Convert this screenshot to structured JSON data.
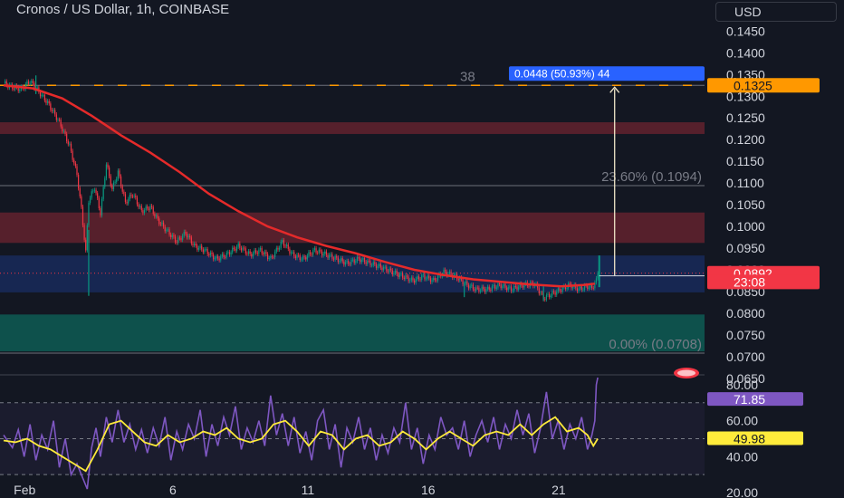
{
  "header": {
    "title": "Cronos / US Dollar, 1h, COINBASE",
    "currency_label": "USD"
  },
  "chart_data": [
    {
      "type": "candlestick",
      "title": "Cronos / US Dollar, 1h, COINBASE",
      "ylim": [
        0.066,
        0.148
      ],
      "y_ticks": [
        "0.1450",
        "0.1400",
        "0.1350",
        "0.1300",
        "0.1250",
        "0.1200",
        "0.1150",
        "0.1100",
        "0.1050",
        "0.1000",
        "0.0950",
        "0.0900",
        "0.0850",
        "0.0800",
        "0.0750",
        "0.0700",
        "0.0650"
      ],
      "x_ticks": [
        {
          "label": "Feb",
          "bar": 2
        },
        {
          "label": "6",
          "bar": 103
        },
        {
          "label": "11",
          "bar": 195
        },
        {
          "label": "16",
          "bar": 277
        },
        {
          "label": "21",
          "bar": 366
        }
      ],
      "price_series": {
        "name": "close",
        "points": [
          [
            0,
            0.133
          ],
          [
            5,
            0.1322
          ],
          [
            12,
            0.1316
          ],
          [
            18,
            0.1335
          ],
          [
            24,
            0.131
          ],
          [
            30,
            0.1285
          ],
          [
            38,
            0.124
          ],
          [
            45,
            0.1185
          ],
          [
            50,
            0.112
          ],
          [
            53,
            0.104
          ],
          [
            56,
            0.094
          ],
          [
            58,
            0.106
          ],
          [
            62,
            0.109
          ],
          [
            66,
            0.103
          ],
          [
            70,
            0.1145
          ],
          [
            74,
            0.1085
          ],
          [
            78,
            0.1125
          ],
          [
            83,
            0.1055
          ],
          [
            88,
            0.1075
          ],
          [
            94,
            0.1035
          ],
          [
            100,
            0.1045
          ],
          [
            105,
            0.1015
          ],
          [
            110,
            0.0995
          ],
          [
            118,
            0.0965
          ],
          [
            124,
            0.0985
          ],
          [
            130,
            0.0955
          ],
          [
            137,
            0.0945
          ],
          [
            145,
            0.0925
          ],
          [
            152,
            0.0935
          ],
          [
            160,
            0.0955
          ],
          [
            168,
            0.0935
          ],
          [
            175,
            0.0945
          ],
          [
            182,
            0.0925
          ],
          [
            190,
            0.0965
          ],
          [
            197,
            0.0935
          ],
          [
            204,
            0.0925
          ],
          [
            212,
            0.0945
          ],
          [
            220,
            0.0935
          ],
          [
            227,
            0.0925
          ],
          [
            234,
            0.0915
          ],
          [
            242,
            0.0925
          ],
          [
            250,
            0.0915
          ],
          [
            258,
            0.0905
          ],
          [
            265,
            0.0895
          ],
          [
            272,
            0.0885
          ],
          [
            279,
            0.0875
          ],
          [
            286,
            0.0885
          ],
          [
            293,
            0.0875
          ],
          [
            300,
            0.0895
          ],
          [
            308,
            0.0885
          ],
          [
            316,
            0.0865
          ],
          [
            322,
            0.0855
          ],
          [
            330,
            0.0855
          ],
          [
            338,
            0.0865
          ],
          [
            346,
            0.0855
          ],
          [
            354,
            0.0865
          ],
          [
            362,
            0.0868
          ],
          [
            368,
            0.0835
          ],
          [
            374,
            0.0845
          ],
          [
            380,
            0.0855
          ],
          [
            386,
            0.0865
          ],
          [
            392,
            0.0855
          ],
          [
            398,
            0.0862
          ],
          [
            401,
            0.0858
          ],
          [
            404,
            0.0875
          ],
          [
            406,
            0.0915
          ]
        ],
        "spikes": [
          {
            "bar": 58,
            "high": 0.0992,
            "low": 0.084
          },
          {
            "bar": 22,
            "high": 0.1348,
            "low": 0.1305
          },
          {
            "bar": 314,
            "high": 0.0868,
            "low": 0.0837
          },
          {
            "bar": 368,
            "high": 0.0862,
            "low": 0.0828
          }
        ]
      },
      "moving_average": {
        "color": "#e52a2a",
        "points": [
          [
            0,
            0.1325
          ],
          [
            20,
            0.1318
          ],
          [
            40,
            0.1295
          ],
          [
            60,
            0.1255
          ],
          [
            80,
            0.121
          ],
          [
            100,
            0.117
          ],
          [
            120,
            0.1125
          ],
          [
            140,
            0.1075
          ],
          [
            160,
            0.1035
          ],
          [
            180,
            0.1
          ],
          [
            200,
            0.0975
          ],
          [
            220,
            0.0955
          ],
          [
            240,
            0.0938
          ],
          [
            260,
            0.0918
          ],
          [
            280,
            0.09
          ],
          [
            300,
            0.0888
          ],
          [
            320,
            0.0878
          ],
          [
            340,
            0.0872
          ],
          [
            360,
            0.0866
          ],
          [
            380,
            0.0862
          ],
          [
            395,
            0.0865
          ],
          [
            403,
            0.0868
          ]
        ]
      },
      "zones": [
        {
          "name": "supply-zone-1",
          "from": 0.1213,
          "to": 0.124,
          "color": "#f23645",
          "opacity": 0.3
        },
        {
          "name": "supply-zone-2",
          "from": 0.0962,
          "to": 0.1032,
          "color": "#f23645",
          "opacity": 0.3
        },
        {
          "name": "demand-zone-1",
          "from": 0.0848,
          "to": 0.0933,
          "color": "#2962ff",
          "opacity": 0.22
        },
        {
          "name": "demand-zone-2",
          "from": 0.0712,
          "to": 0.0797,
          "color": "#089981",
          "opacity": 0.45
        }
      ],
      "fib_levels": [
        {
          "label": "38",
          "price": 0.1325
        },
        {
          "label": "23.60% (0.1094)",
          "price": 0.1094
        },
        {
          "label": "0.00% (0.0708)",
          "price": 0.0708
        }
      ],
      "dashed_target": {
        "price": 0.1325,
        "color": "#ff9800"
      },
      "measure": {
        "label": "0.0448 (50.93%) 44",
        "from_price": 0.0886,
        "to_price": 0.1325,
        "bar": 406
      },
      "price_tags": [
        {
          "text": "0.1325",
          "price": 0.1325,
          "bg": "#ff9800",
          "fg": "#131722"
        },
        {
          "text": "0.0892",
          "price": 0.0892,
          "bg": "#f23645",
          "fg": "#ffffff"
        },
        {
          "text": "23:08",
          "price": 0.0872,
          "bg": "#f23645",
          "fg": "#ffffff"
        }
      ]
    },
    {
      "type": "line",
      "title": "",
      "ylim": [
        18,
        85
      ],
      "y_ticks": [
        "80.00",
        "60.00",
        "40.00",
        "20.00"
      ],
      "levels": [
        70,
        50,
        30
      ],
      "series": [
        {
          "color": "#7e57c2",
          "points": [
            [
              0,
              52
            ],
            [
              6,
              45
            ],
            [
              10,
              55
            ],
            [
              14,
              40
            ],
            [
              18,
              58
            ],
            [
              22,
              38
            ],
            [
              26,
              52
            ],
            [
              30,
              44
            ],
            [
              34,
              60
            ],
            [
              38,
              34
            ],
            [
              42,
              50
            ],
            [
              46,
              30
            ],
            [
              50,
              36
            ],
            [
              54,
              28
            ],
            [
              57,
              22
            ],
            [
              60,
              45
            ],
            [
              63,
              56
            ],
            [
              66,
              40
            ],
            [
              70,
              62
            ],
            [
              74,
              48
            ],
            [
              78,
              66
            ],
            [
              82,
              48
            ],
            [
              86,
              58
            ],
            [
              90,
              44
            ],
            [
              94,
              55
            ],
            [
              98,
              42
            ],
            [
              102,
              56
            ],
            [
              106,
              46
            ],
            [
              110,
              62
            ],
            [
              114,
              38
            ],
            [
              118,
              54
            ],
            [
              122,
              44
            ],
            [
              126,
              58
            ],
            [
              130,
              50
            ],
            [
              134,
              66
            ],
            [
              138,
              40
            ],
            [
              142,
              58
            ],
            [
              146,
              46
            ],
            [
              150,
              62
            ],
            [
              154,
              52
            ],
            [
              158,
              68
            ],
            [
              162,
              44
            ],
            [
              166,
              56
            ],
            [
              170,
              48
            ],
            [
              174,
              60
            ],
            [
              178,
              46
            ],
            [
              182,
              74
            ],
            [
              186,
              52
            ],
            [
              190,
              64
            ],
            [
              194,
              46
            ],
            [
              198,
              62
            ],
            [
              202,
              42
            ],
            [
              206,
              54
            ],
            [
              210,
              38
            ],
            [
              214,
              60
            ],
            [
              218,
              66
            ],
            [
              222,
              44
            ],
            [
              226,
              58
            ],
            [
              230,
              34
            ],
            [
              234,
              56
            ],
            [
              238,
              48
            ],
            [
              242,
              62
            ],
            [
              246,
              44
            ],
            [
              250,
              56
            ],
            [
              254,
              38
            ],
            [
              258,
              52
            ],
            [
              262,
              42
            ],
            [
              266,
              56
            ],
            [
              270,
              48
            ],
            [
              274,
              70
            ],
            [
              278,
              44
            ],
            [
              282,
              56
            ],
            [
              286,
              36
            ],
            [
              290,
              52
            ],
            [
              294,
              44
            ],
            [
              298,
              62
            ],
            [
              302,
              52
            ],
            [
              306,
              56
            ],
            [
              310,
              44
            ],
            [
              314,
              60
            ],
            [
              318,
              40
            ],
            [
              322,
              52
            ],
            [
              326,
              60
            ],
            [
              330,
              48
            ],
            [
              334,
              62
            ],
            [
              338,
              44
            ],
            [
              342,
              58
            ],
            [
              346,
              50
            ],
            [
              350,
              66
            ],
            [
              354,
              52
            ],
            [
              358,
              64
            ],
            [
              362,
              42
            ],
            [
              366,
              56
            ],
            [
              370,
              76
            ],
            [
              374,
              50
            ],
            [
              378,
              60
            ],
            [
              382,
              44
            ],
            [
              386,
              58
            ],
            [
              390,
              50
            ],
            [
              394,
              62
            ],
            [
              398,
              44
            ],
            [
              401,
              52
            ],
            [
              403,
              60
            ],
            [
              404,
              80
            ],
            [
              405,
              84
            ]
          ]
        },
        {
          "color": "#ffeb3b",
          "points": [
            [
              0,
              49
            ],
            [
              8,
              48
            ],
            [
              16,
              50
            ],
            [
              24,
              46
            ],
            [
              32,
              44
            ],
            [
              40,
              40
            ],
            [
              48,
              36
            ],
            [
              56,
              32
            ],
            [
              64,
              44
            ],
            [
              72,
              58
            ],
            [
              80,
              60
            ],
            [
              88,
              54
            ],
            [
              96,
              48
            ],
            [
              104,
              46
            ],
            [
              112,
              52
            ],
            [
              120,
              48
            ],
            [
              128,
              50
            ],
            [
              136,
              54
            ],
            [
              144,
              52
            ],
            [
              152,
              56
            ],
            [
              160,
              50
            ],
            [
              168,
              48
            ],
            [
              176,
              50
            ],
            [
              184,
              58
            ],
            [
              192,
              60
            ],
            [
              200,
              54
            ],
            [
              208,
              46
            ],
            [
              216,
              54
            ],
            [
              224,
              52
            ],
            [
              232,
              44
            ],
            [
              240,
              50
            ],
            [
              248,
              52
            ],
            [
              256,
              46
            ],
            [
              264,
              48
            ],
            [
              272,
              54
            ],
            [
              280,
              50
            ],
            [
              288,
              44
            ],
            [
              296,
              50
            ],
            [
              304,
              54
            ],
            [
              312,
              50
            ],
            [
              320,
              46
            ],
            [
              328,
              52
            ],
            [
              336,
              54
            ],
            [
              344,
              52
            ],
            [
              352,
              58
            ],
            [
              360,
              52
            ],
            [
              368,
              58
            ],
            [
              376,
              62
            ],
            [
              384,
              54
            ],
            [
              392,
              56
            ],
            [
              398,
              52
            ],
            [
              402,
              46
            ],
            [
              405,
              50
            ]
          ]
        }
      ],
      "value_tags": [
        {
          "text": "71.85",
          "value": 71.85,
          "bg": "#7e57c2",
          "fg": "#ffffff"
        },
        {
          "text": "49.98",
          "value": 49.98,
          "bg": "#ffeb3b",
          "fg": "#131722"
        }
      ]
    }
  ]
}
